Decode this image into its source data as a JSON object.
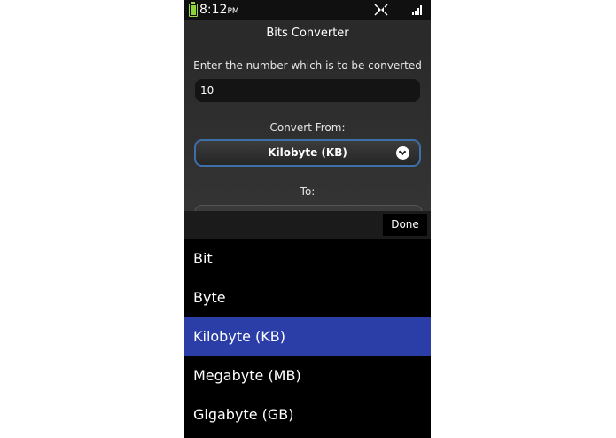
{
  "status_bar": {
    "time": "8:12",
    "ampm": "PM"
  },
  "app": {
    "title": "Bits Converter"
  },
  "form": {
    "input_label": "Enter the number which is to be converted",
    "input_value": "10",
    "from_label": "Convert From:",
    "from_value": "Kilobyte (KB)",
    "to_label": "To:"
  },
  "picker": {
    "done_label": "Done",
    "options": [
      "Bit",
      "Byte",
      "Kilobyte (KB)",
      "Megabyte (MB)",
      "Gigabyte (GB)"
    ],
    "selected": "Kilobyte (KB)"
  },
  "colors": {
    "selected_bg": "#2b3ea8",
    "focus_border": "#3d6fa8",
    "battery": "#8ed33b"
  }
}
